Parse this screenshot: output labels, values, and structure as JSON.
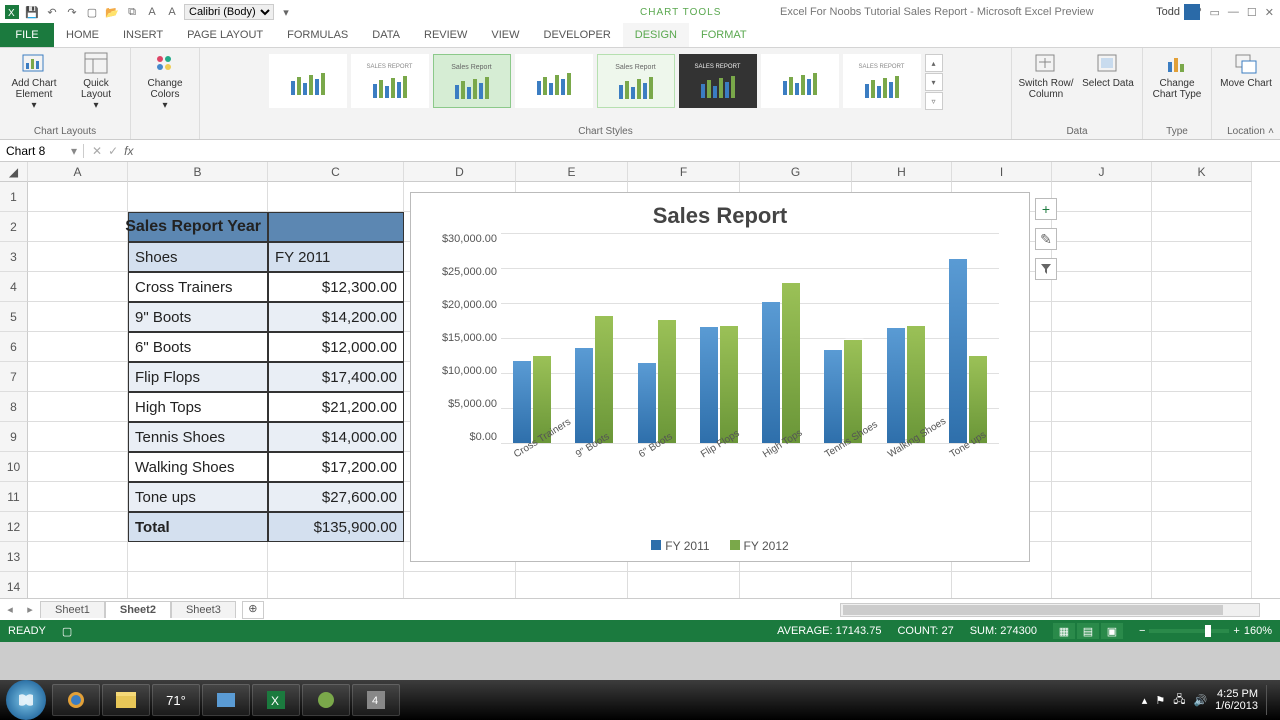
{
  "title": "Excel For Noobs Tutorial Sales Report - Microsoft Excel Preview",
  "charttools_label": "CHART TOOLS",
  "user": "Todd",
  "tabs": {
    "file": "FILE",
    "home": "HOME",
    "insert": "INSERT",
    "pagelayout": "PAGE LAYOUT",
    "formulas": "FORMULAS",
    "data": "DATA",
    "review": "REVIEW",
    "view": "VIEW",
    "developer": "DEVELOPER",
    "design": "DESIGN",
    "format": "FORMAT"
  },
  "ribbon": {
    "groups": {
      "layouts": "Chart Layouts",
      "styles": "Chart Styles",
      "data": "Data",
      "type": "Type",
      "loc": "Location"
    },
    "buttons": {
      "addel": "Add Chart Element",
      "quick": "Quick Layout",
      "colors": "Change Colors",
      "switch": "Switch Row/ Column",
      "seldata": "Select Data",
      "chtype": "Change Chart Type",
      "move": "Move Chart"
    }
  },
  "font_picker": "Calibri (Body)",
  "namebox": "Chart 8",
  "fx_label": "fx",
  "cols": [
    "A",
    "B",
    "C",
    "D",
    "E",
    "F",
    "G",
    "H",
    "I",
    "J",
    "K"
  ],
  "table": {
    "title": "Sales Report Year",
    "h1": "Shoes",
    "h2": "FY 2011",
    "rows": [
      {
        "name": "Cross Trainers",
        "val": "$12,300.00"
      },
      {
        "name": "9\" Boots",
        "val": "$14,200.00"
      },
      {
        "name": "6\" Boots",
        "val": "$12,000.00"
      },
      {
        "name": "Flip Flops",
        "val": "$17,400.00"
      },
      {
        "name": "High Tops",
        "val": "$21,200.00"
      },
      {
        "name": "Tennis Shoes",
        "val": "$14,000.00"
      },
      {
        "name": "Walking Shoes",
        "val": "$17,200.00"
      },
      {
        "name": "Tone ups",
        "val": "$27,600.00"
      }
    ],
    "total_label": "Total",
    "total_val": "$135,900.00"
  },
  "chart_data": {
    "type": "bar",
    "title": "Sales Report",
    "ylabel": "",
    "yticks": [
      "$30,000.00",
      "$25,000.00",
      "$20,000.00",
      "$15,000.00",
      "$10,000.00",
      "$5,000.00",
      "$0.00"
    ],
    "ylim": [
      0,
      30000
    ],
    "categories": [
      "Cross Trainers",
      "9\" Boots",
      "6\" Boots",
      "Flip Flops",
      "High Tops",
      "Tennis Shoes",
      "Walking Shoes",
      "Tone ups"
    ],
    "series": [
      {
        "name": "FY 2011",
        "values": [
          12300,
          14200,
          12000,
          17400,
          21200,
          14000,
          17200,
          27600
        ]
      },
      {
        "name": "FY 2012",
        "values": [
          13000,
          19000,
          18500,
          17600,
          24000,
          15500,
          17500,
          13000
        ]
      }
    ]
  },
  "sheets": {
    "s1": "Sheet1",
    "s2": "Sheet2",
    "s3": "Sheet3"
  },
  "status": {
    "ready": "READY",
    "avg": "AVERAGE: 17143.75",
    "count": "COUNT: 27",
    "sum": "SUM: 274300",
    "zoom": "160%"
  },
  "tray": {
    "time": "4:25 PM",
    "date": "1/6/2013",
    "temp": "71°"
  }
}
